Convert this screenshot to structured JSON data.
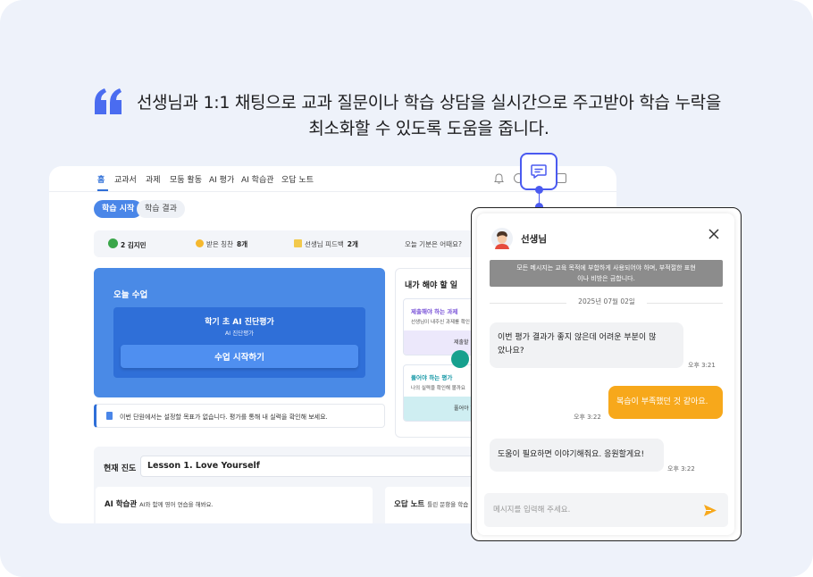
{
  "headline": {
    "line1": "선생님과 1:1 채팅으로 교과 질문이나 학습 상담을 실시간으로 주고받아 학습 누락을",
    "line2": "최소화할 수 있도록 도움을 줍니다."
  },
  "colors": {
    "accent_blue": "#2f6fd8",
    "connector": "#4a5af0",
    "outgoing_bubble": "#f7a81b",
    "background": "#eef2fa"
  },
  "app": {
    "nav": [
      "홈",
      "교과서",
      "과제",
      "모둠 활동",
      "AI 평가",
      "AI 학습관",
      "오답 노트"
    ],
    "pills": {
      "active": "학습 시작",
      "inactive": "학습 결과"
    },
    "stats": [
      {
        "label": "2 김지민",
        "value": ""
      },
      {
        "label": "받은 칭찬",
        "value": "8개"
      },
      {
        "label": "선생님 피드백",
        "value": "2개"
      },
      {
        "label": "오늘 기분은 어때요?",
        "value": ""
      }
    ],
    "today": {
      "title": "오늘 수업",
      "lesson_title": "학기 초 AI 진단평가",
      "lesson_sub": "AI 진단평가",
      "start_button": "수업 시작하기"
    },
    "notice": "이번 단원에서는 설정할 목표가 없습니다. 평가를 통해 내 실력을 확인해 보세요.",
    "todo": {
      "title": "내가 해야 할 일",
      "task1": {
        "label": "제출해야 하는 과제",
        "desc": "선생님이 내주신 과제를 확인",
        "footer": "제출할"
      },
      "task2": {
        "label": "풀어야 하는 평가",
        "desc": "나의 실력을 확인해 볼까요",
        "footer": "풀어야 할"
      }
    },
    "progress": {
      "label": "현재 진도",
      "value": "Lesson 1. Love Yourself"
    },
    "ai_center": {
      "title": "AI 학습관",
      "sub": "AI와 함께 영어 연습을 해봐요."
    },
    "wrong_note": {
      "title": "오답 노트",
      "sub": "틀린 문항을 학습"
    }
  },
  "chat": {
    "title": "선생님",
    "policy_line1": "모든 메시지는 교육 목적에 부합하게 사용되어야 하며, 부적절한 표현",
    "policy_line2": "이나 비방은 금합니다.",
    "date": "2025년 07월 02일",
    "messages": [
      {
        "from": "teacher",
        "line1": "이번 평가 결과가 좋지 않은데 어려운 부분이 많",
        "line2": "았나요?",
        "time": "오후 3:21"
      },
      {
        "from": "student",
        "text": "복습이 부족했던 것 같아요.",
        "time": "오후 3:22"
      },
      {
        "from": "teacher",
        "text": "도움이 필요하면 이야기해줘요. 응원할게요!",
        "time": "오후 3:22"
      }
    ],
    "input_placeholder": "메시지를 입력해 주세요.",
    "icons": {
      "avatar": "teacher-avatar",
      "close": "close-icon",
      "send": "send-icon",
      "header": "chat-bubble-icon"
    }
  }
}
